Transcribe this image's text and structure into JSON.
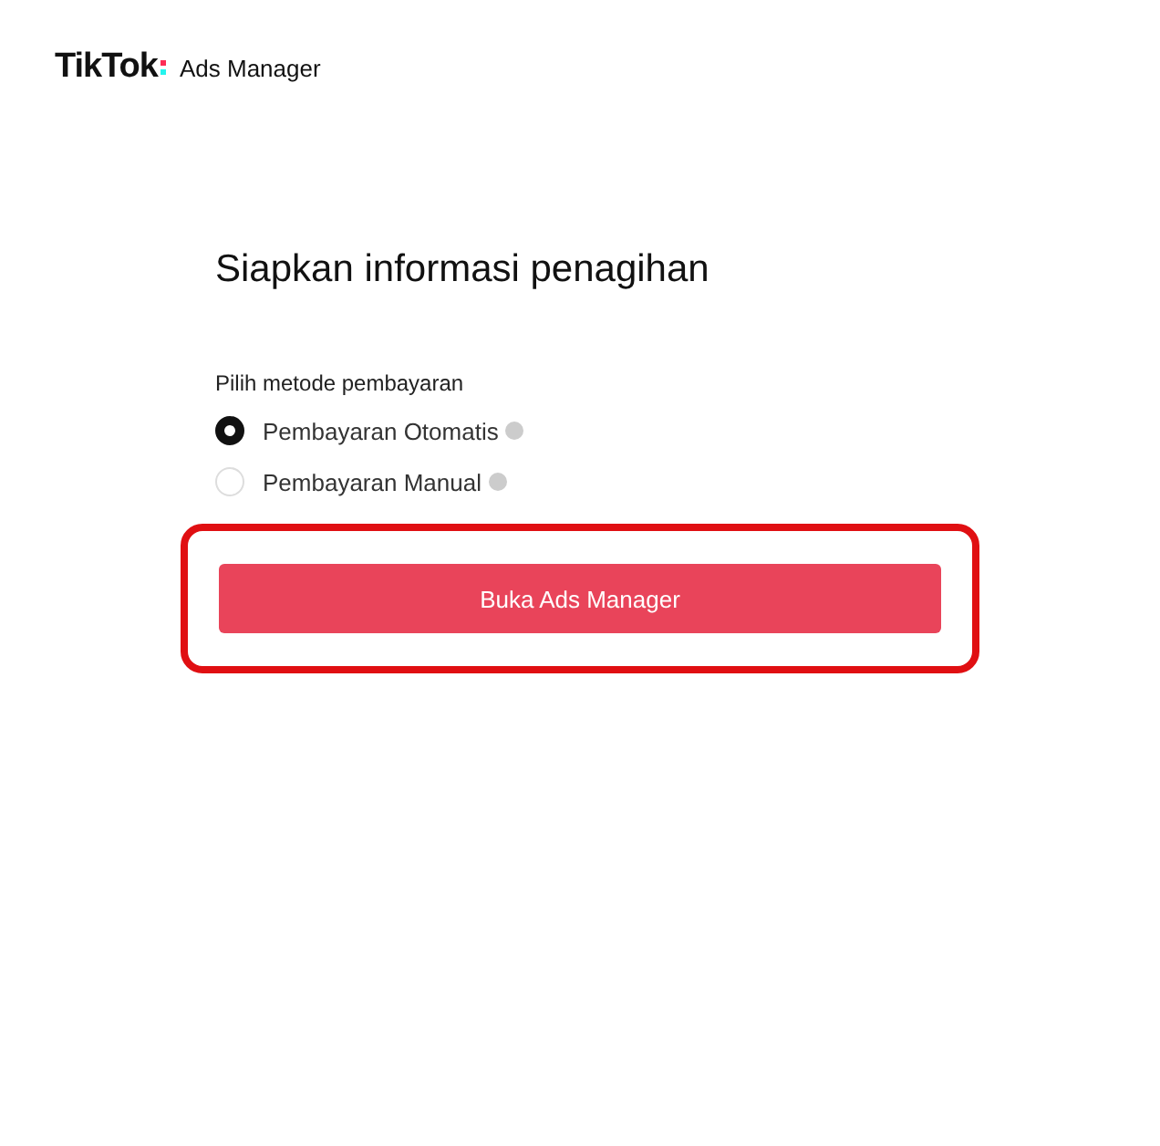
{
  "header": {
    "brand": "TikTok",
    "product": "Ads Manager"
  },
  "title": "Siapkan informasi penagihan",
  "payment": {
    "label": "Pilih metode pembayaran",
    "options": [
      {
        "label": "Pembayaran Otomatis",
        "selected": true
      },
      {
        "label": "Pembayaran Manual",
        "selected": false
      }
    ]
  },
  "button": {
    "label": "Buka Ads Manager",
    "highlighted": true
  }
}
